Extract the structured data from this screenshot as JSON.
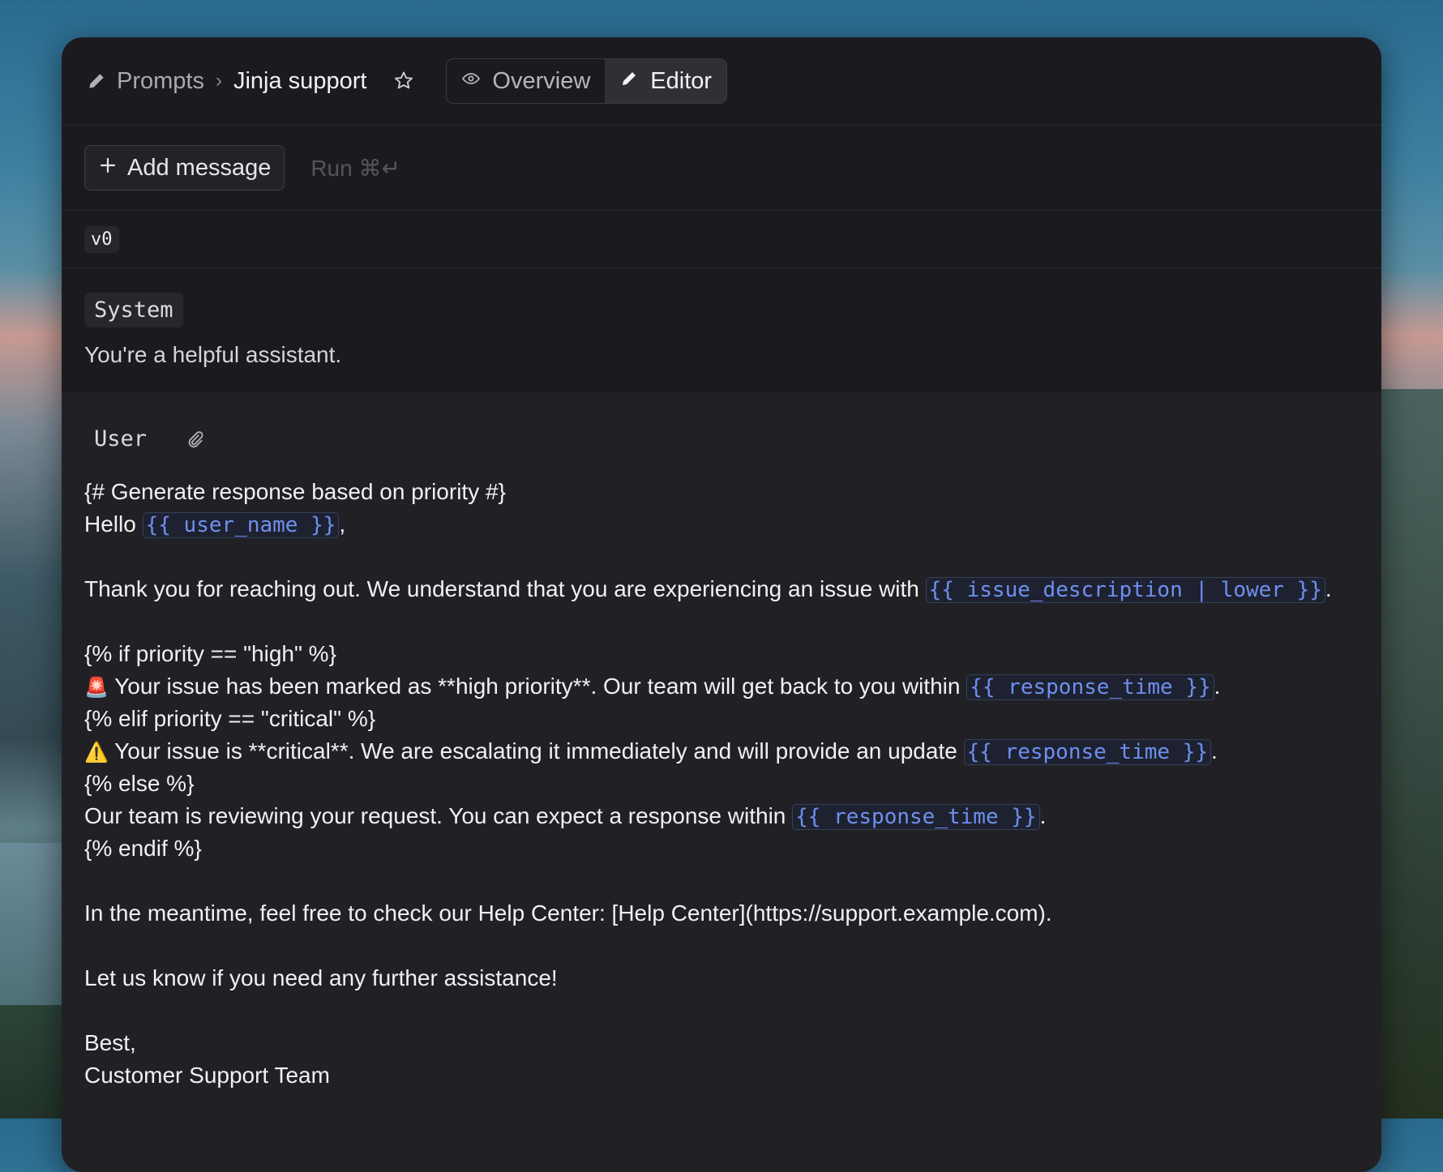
{
  "header": {
    "breadcrumb_root": "Prompts",
    "breadcrumb_separator": "›",
    "breadcrumb_current": "Jinja support",
    "tabs": [
      {
        "label": "Overview",
        "icon": "eye-icon",
        "active": false
      },
      {
        "label": "Editor",
        "icon": "pencil-icon",
        "active": true
      }
    ]
  },
  "toolbar": {
    "add_label": "Add message",
    "run_label": "Run ⌘↵"
  },
  "version": "v0",
  "system": {
    "role": "System",
    "text": "You're a helpful assistant."
  },
  "user": {
    "role": "User",
    "lines": {
      "l1": "{# Generate response based on priority #}",
      "l2a": "Hello ",
      "l2v": "{{ user_name }}",
      "l2b": ",",
      "l3a": "Thank you for reaching out. We understand that you are experiencing an issue with ",
      "l3v": "{{ issue_description | lower }}",
      "l3b": ".",
      "l4": "{% if priority == \"high\" %}",
      "l5e": "🚨",
      "l5a": " Your issue has been marked as **high priority**. Our team will get back to you within ",
      "l5v": "{{ response_time }}",
      "l5b": ".",
      "l6": "{% elif priority == \"critical\" %}",
      "l7e": "⚠️",
      "l7a": " Your issue is **critical**. We are escalating it immediately and will provide an update ",
      "l7v": "{{ response_time }}",
      "l7b": ".",
      "l8": "{% else %}",
      "l9a": "Our team is reviewing your request. You can expect a response within ",
      "l9v": "{{ response_time }}",
      "l9b": ".",
      "l10": "{% endif %}",
      "l11": "In the meantime, feel free to check our Help Center: [Help Center](https://support.example.com).",
      "l12": "Let us know if you need any further assistance!",
      "l13": "Best,",
      "l14": "Customer Support Team"
    }
  },
  "colors": {
    "accent_variable": "#6f8ff0",
    "background": "#1b1b1f",
    "user_panel": "#212125"
  }
}
